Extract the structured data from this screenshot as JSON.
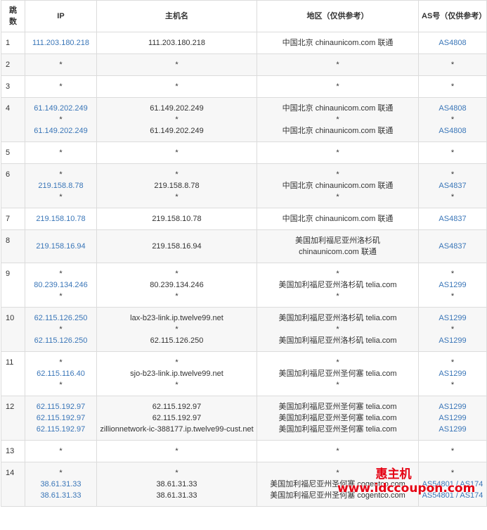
{
  "headers": {
    "hop": "跳数",
    "ip": "IP",
    "hostname": "主机名",
    "region": "地区（仅供参考）",
    "as": "AS号（仅供参考）"
  },
  "rows": [
    {
      "hop": "1",
      "ip": [
        "111.203.180.218"
      ],
      "host": [
        "111.203.180.218"
      ],
      "region": [
        "中国北京 chinaunicom.com 联通"
      ],
      "as": [
        "AS4808"
      ]
    },
    {
      "hop": "2",
      "ip": [
        "*"
      ],
      "host": [
        "*"
      ],
      "region": [
        "*"
      ],
      "as": [
        "*"
      ]
    },
    {
      "hop": "3",
      "ip": [
        "*"
      ],
      "host": [
        "*"
      ],
      "region": [
        "*"
      ],
      "as": [
        "*"
      ]
    },
    {
      "hop": "4",
      "ip": [
        "61.149.202.249",
        "*",
        "61.149.202.249"
      ],
      "host": [
        "61.149.202.249",
        "*",
        "61.149.202.249"
      ],
      "region": [
        "中国北京 chinaunicom.com 联通",
        "*",
        "中国北京 chinaunicom.com 联通"
      ],
      "as": [
        "AS4808",
        "*",
        "AS4808"
      ]
    },
    {
      "hop": "5",
      "ip": [
        "*"
      ],
      "host": [
        "*"
      ],
      "region": [
        "*"
      ],
      "as": [
        "*"
      ]
    },
    {
      "hop": "6",
      "ip": [
        "*",
        "219.158.8.78",
        "*"
      ],
      "host": [
        "*",
        "219.158.8.78",
        "*"
      ],
      "region": [
        "*",
        "中国北京 chinaunicom.com 联通",
        "*"
      ],
      "as": [
        "*",
        "AS4837",
        "*"
      ]
    },
    {
      "hop": "7",
      "ip": [
        "219.158.10.78"
      ],
      "host": [
        "219.158.10.78"
      ],
      "region": [
        "中国北京 chinaunicom.com 联通"
      ],
      "as": [
        "AS4837"
      ]
    },
    {
      "hop": "8",
      "ip": [
        "219.158.16.94"
      ],
      "host": [
        "219.158.16.94"
      ],
      "region": [
        "美国加利福尼亚州洛杉矶",
        "chinaunicom.com 联通"
      ],
      "as": [
        "AS4837"
      ]
    },
    {
      "hop": "9",
      "ip": [
        "*",
        "80.239.134.246",
        "*"
      ],
      "host": [
        "*",
        "80.239.134.246",
        "*"
      ],
      "region": [
        "*",
        "美国加利福尼亚州洛杉矶 telia.com",
        "*"
      ],
      "as": [
        "*",
        "AS1299",
        "*"
      ]
    },
    {
      "hop": "10",
      "ip": [
        "62.115.126.250",
        "*",
        "62.115.126.250"
      ],
      "host": [
        "lax-b23-link.ip.twelve99.net",
        "*",
        "62.115.126.250"
      ],
      "region": [
        "美国加利福尼亚州洛杉矶 telia.com",
        "*",
        "美国加利福尼亚州洛杉矶 telia.com"
      ],
      "as": [
        "AS1299",
        "*",
        "AS1299"
      ]
    },
    {
      "hop": "11",
      "ip": [
        "*",
        "62.115.116.40",
        "*"
      ],
      "host": [
        "*",
        "sjo-b23-link.ip.twelve99.net",
        "*"
      ],
      "region": [
        "*",
        "美国加利福尼亚州圣何塞 telia.com",
        "*"
      ],
      "as": [
        "*",
        "AS1299",
        "*"
      ]
    },
    {
      "hop": "12",
      "ip": [
        "62.115.192.97",
        "62.115.192.97",
        "62.115.192.97"
      ],
      "host": [
        "62.115.192.97",
        "62.115.192.97",
        "zillionnetwork-ic-388177.ip.twelve99-cust.net"
      ],
      "region": [
        "美国加利福尼亚州圣何塞 telia.com",
        "美国加利福尼亚州圣何塞 telia.com",
        "美国加利福尼亚州圣何塞 telia.com"
      ],
      "as": [
        "AS1299",
        "AS1299",
        "AS1299"
      ]
    },
    {
      "hop": "13",
      "ip": [
        "*"
      ],
      "host": [
        "*"
      ],
      "region": [
        "*"
      ],
      "as": [
        "*"
      ]
    },
    {
      "hop": "14",
      "ip": [
        "*",
        "38.61.31.33",
        "38.61.31.33"
      ],
      "host": [
        "*",
        "38.61.31.33",
        "38.61.31.33"
      ],
      "region": [
        "*",
        "美国加利福尼亚州圣何塞 cogentco.com",
        "美国加利福尼亚州圣何塞 cogentco.com"
      ],
      "as": [
        "*",
        "AS54801 / AS174",
        "AS54801 / AS174"
      ]
    }
  ],
  "watermark": {
    "line1": "惠主机",
    "line2": "www.idccoupon.com"
  },
  "colors": {
    "link": "#3a76b8",
    "watermark": "#e50012",
    "alt_row": "#f7f7f7",
    "border": "#dcdcdc"
  }
}
